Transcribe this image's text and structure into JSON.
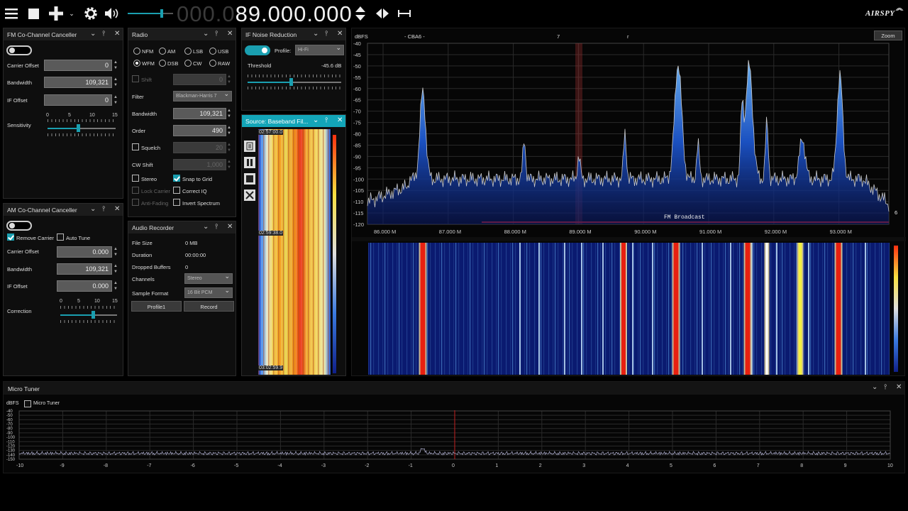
{
  "toolbar": {
    "menu_icon": "hamburger-menu-icon",
    "stop_icon": "stop-icon",
    "add_icon": "plus-icon",
    "settings_icon": "gear-icon",
    "volume_icon": "speaker-icon",
    "volume_level": 0.75,
    "freq_dim": "000.0",
    "freq_lit": "89.000.000",
    "brand": "AIRSPY"
  },
  "fm_cc": {
    "title": "FM Co-Channel Canceller",
    "carrier_offset_label": "Carrier Offset",
    "carrier_offset": "0",
    "bandwidth_label": "Bandwidth",
    "bandwidth": "109,321",
    "if_offset_label": "IF Offset",
    "if_offset": "0",
    "sensitivity_label": "Sensitivity",
    "ticks": [
      "0",
      "5",
      "10",
      "15"
    ]
  },
  "am_cc": {
    "title": "AM Co-Channel Canceller",
    "remove_carrier": "Remove Carrier",
    "auto_tune": "Auto Tune",
    "carrier_offset_label": "Carrier Offset",
    "carrier_offset": "0.000",
    "bandwidth_label": "Bandwidth",
    "bandwidth": "109,321",
    "if_offset_label": "IF Offset",
    "if_offset": "0.000",
    "correction_label": "Correction",
    "ticks": [
      "0",
      "5",
      "10",
      "15"
    ]
  },
  "radio": {
    "title": "Radio",
    "modes": [
      "NFM",
      "AM",
      "LSB",
      "USB",
      "WFM",
      "DSB",
      "CW",
      "RAW"
    ],
    "selected_mode": "WFM",
    "shift_label": "Shift",
    "shift": "0",
    "filter_label": "Filter",
    "filter": "Blackman-Harris 7",
    "bandwidth_label": "Bandwidth",
    "bandwidth": "109,321",
    "order_label": "Order",
    "order": "490",
    "squelch_label": "Squelch",
    "squelch": "20",
    "cw_shift_label": "CW Shift",
    "cw_shift": "1,000",
    "stereo": "Stereo",
    "snap_to_grid": "Snap to Grid",
    "lock_carrier": "Lock Carrier",
    "correct_iq": "Correct IQ",
    "anti_fading": "Anti-Fading",
    "invert_spectrum": "Invert Spectrum"
  },
  "recorder": {
    "title": "Audio Recorder",
    "file_size_label": "File Size",
    "file_size": "0 MB",
    "duration_label": "Duration",
    "duration": "00:00:00",
    "dropped_label": "Dropped Buffers",
    "dropped": "0",
    "channels_label": "Channels",
    "channels": "Stereo",
    "format_label": "Sample Format",
    "format": "16 Bit PCM",
    "profile_button": "Profile1",
    "record_button": "Record"
  },
  "if_nr": {
    "title": "IF Noise Reduction",
    "profile_label": "Profile:",
    "profile": "Hi-Fi",
    "threshold_label": "Threshold",
    "threshold": "-45.6 dB"
  },
  "source": {
    "title": "Source: Baseband Fil...",
    "times": [
      "02:57:00.0",
      "02:59:38.0",
      "03:02:59.9"
    ]
  },
  "spectrum": {
    "unit": "dBFS",
    "top_labels": [
      "- CBA6 -",
      "7",
      "r"
    ],
    "zoom_button": "Zoom",
    "band_label": "FM Broadcast",
    "y_ticks": [
      "-40",
      "-45",
      "-50",
      "-55",
      "-60",
      "-65",
      "-70",
      "-75",
      "-80",
      "-85",
      "-90",
      "-95",
      "-100",
      "-105",
      "-110",
      "-115",
      "-120"
    ],
    "x_ticks": [
      "86.000 M",
      "87.000 M",
      "88.000 M",
      "89.000 M",
      "90.000 M",
      "91.000 M",
      "92.000 M",
      "93.000 M"
    ],
    "right_marker": "6"
  },
  "micro_tuner": {
    "title": "Micro Tuner",
    "unit": "dBFS",
    "checkbox_label": "Micro Tuner",
    "y_ticks": [
      "-40",
      "-50",
      "-60",
      "-70",
      "-80",
      "-90",
      "-100",
      "-110",
      "-120",
      "-130",
      "-140",
      "-150"
    ],
    "x_ticks": [
      "-10",
      "-9",
      "-8",
      "-7",
      "-6",
      "-5",
      "-4",
      "-3",
      "-2",
      "-1",
      "0",
      "1",
      "2",
      "3",
      "4",
      "5",
      "6",
      "7",
      "8",
      "9",
      "10"
    ]
  }
}
